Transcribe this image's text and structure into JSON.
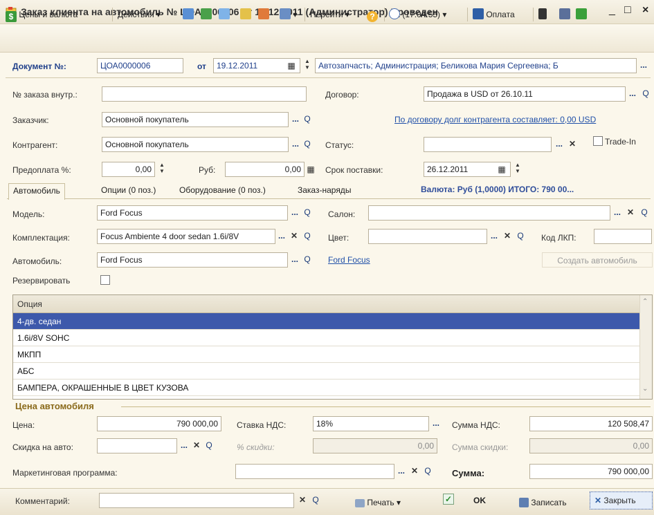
{
  "window": {
    "title": "Заказ клиента на автомобиль № ЦОА0000006 от 19.12.2011 (Администратор) Проведен",
    "min": "_",
    "max": "□",
    "close": "×"
  },
  "toolbar": {
    "prices": "Цены и валюта",
    "actions": "Действия",
    "goto": "Перейти",
    "time": "(17:04:55)",
    "pay": "Оплата"
  },
  "header": {
    "doc_label": "Документ №:",
    "doc_number": "ЦОА0000006",
    "from_label": "от",
    "date": "19.12.2011",
    "org": "Автозапчасть; Администрация; Беликова Мария Сергеевна; Б"
  },
  "form": {
    "order_label": "№ заказа внутр.:",
    "order_value": "",
    "contract_label": "Договор:",
    "contract_value": "Продажа в USD от 26.10.11",
    "customer_label": "Заказчик:",
    "customer_value": "Основной покупатель",
    "debt_link": "По договору долг контрагента составляет: 0,00 USD",
    "counterparty_label": "Контрагент:",
    "counterparty_value": "Основной покупатель",
    "status_label": "Статус:",
    "status_value": "",
    "tradein_label": "Trade-In",
    "prepay_label": "Предоплата %:",
    "prepay_value": "0,00",
    "rub_label": "Руб:",
    "rub_value": "0,00",
    "delivery_label": "Срок поставки:",
    "delivery_value": "26.12.2011"
  },
  "tabs": [
    {
      "label": "Автомобиль"
    },
    {
      "label": "Опции (0 поз.)"
    },
    {
      "label": "Оборудование (0 поз.)"
    },
    {
      "label": "Заказ-наряды"
    }
  ],
  "currency_total": "Валюта: Руб (1,0000) ИТОГО: 790 00...",
  "car": {
    "model_label": "Модель:",
    "model_value": "Ford Focus",
    "salon_label": "Салон:",
    "salon_value": "",
    "kit_label": "Комплектация:",
    "kit_value": "Focus Ambiente 4 door sedan 1.6i/8V",
    "color_label": "Цвет:",
    "color_value": "",
    "lkp_label": "Код ЛКП:",
    "lkp_value": "",
    "auto_label": "Автомобиль:",
    "auto_value": "Ford Focus",
    "auto_link": "Ford Focus",
    "create_auto": "Создать автомобиль",
    "reserve_label": "Резервировать"
  },
  "options": {
    "header": "Опция",
    "rows": [
      "4-дв. седан",
      "1.6i/8V SOHC",
      "МКПП",
      "АБС",
      "БАМПЕРА, ОКРАШЕННЫЕ В ЦВЕТ КУЗОВА"
    ]
  },
  "price": {
    "section_title": "Цена автомобиля",
    "price_label": "Цена:",
    "price_value": "790 000,00",
    "vat_rate_label": "Ставка НДС:",
    "vat_rate_value": "18%",
    "vat_sum_label": "Сумма НДС:",
    "vat_sum_value": "120 508,47",
    "discount_label": "Скидка на авто:",
    "discount_value": "",
    "discount_pct_label": "% скидки:",
    "discount_pct_value": "0,00",
    "discount_sum_label": "Сумма скидки:",
    "discount_sum_value": "0,00",
    "marketing_label": "Маркетинговая программа:",
    "marketing_value": "",
    "total_label": "Сумма:",
    "total_value": "790 000,00"
  },
  "bottom": {
    "comment_label": "Комментарий:",
    "comment_value": "",
    "print": "Печать",
    "ok": "OK",
    "save": "Записать",
    "close": "Закрыть"
  }
}
